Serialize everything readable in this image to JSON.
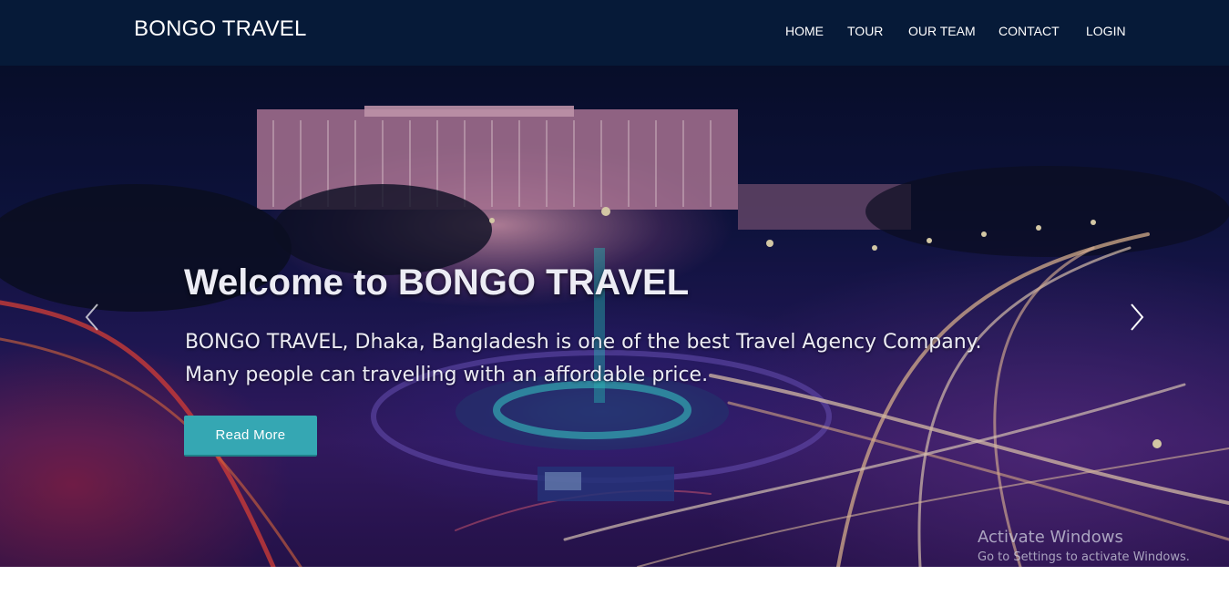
{
  "navbar": {
    "brand": "BONGO TRAVEL",
    "links": [
      "HOME",
      "TOUR",
      "OUR TEAM",
      "CONTACT",
      "LOGIN"
    ],
    "background": "#061a38"
  },
  "hero": {
    "title": "Welcome to BONGO TRAVEL",
    "description": "BONGO TRAVEL, Dhaka, Bangladesh is one of the best Travel Agency Company. Many people can travelling with an affordable price.",
    "button_label": "Read More",
    "button_color": "#35a7b3",
    "prev_icon": "chevron-left-icon",
    "next_icon": "chevron-right-icon"
  },
  "watermark": {
    "title": "Activate Windows",
    "subtitle": "Go to Settings to activate Windows."
  }
}
